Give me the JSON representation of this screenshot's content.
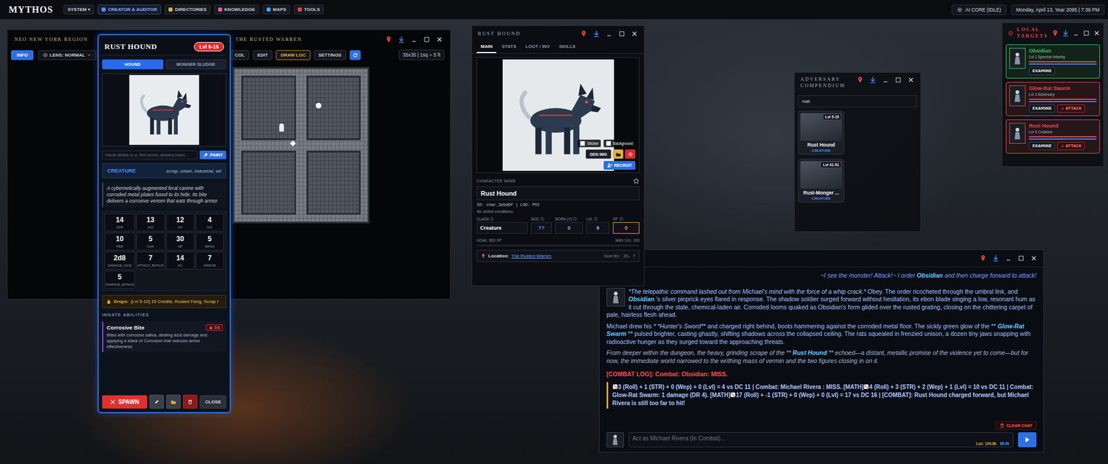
{
  "topbar": {
    "logo": "MYTHOS",
    "menu": [
      {
        "label": "SYSTEM ▾",
        "color": "",
        "selected": false
      },
      {
        "label": "CREATOR & AUDITOR",
        "color": "#5b8cff",
        "selected": true
      },
      {
        "label": "DIRECTORIES",
        "color": "#e0b040",
        "selected": false
      },
      {
        "label": "KNOWLEDGE",
        "color": "#e05fa8",
        "selected": false
      },
      {
        "label": "MAPS",
        "color": "#4aa3ff",
        "selected": false
      },
      {
        "label": "TOOLS",
        "color": "#e04848",
        "selected": false
      }
    ],
    "ai_status": "AI CORE (IDLE)",
    "clock": "Monday, April 13, Year 2095 | 7:36 PM"
  },
  "map_window": {
    "title_left": "NEO NEW YORK REGION",
    "title_right": "THE RUSTED WARREN",
    "toolbar_left": [
      {
        "label": "INFO",
        "kind": "primary"
      },
      {
        "label": "LENS: NORMAL",
        "kind": "select"
      }
    ],
    "toolbar_right": [
      {
        "label": "COL",
        "kind": "plain"
      },
      {
        "label": "EDIT",
        "kind": "plain"
      },
      {
        "label": "DRAW LOC",
        "kind": "warn"
      },
      {
        "label": "SETTINGS",
        "kind": "plain"
      }
    ],
    "scale": "35x35 | 1sq = 5 ft"
  },
  "hound_card": {
    "title": "RUST HOUND",
    "level": "Lvl 5-15",
    "tabs": [
      {
        "label": "HOUND",
        "selected": true
      },
      {
        "label": "MONGER SLUDGE",
        "selected": false
      }
    ],
    "visual_placeholder": "Visual details (e.g. Red armor, glowing eyes)...",
    "paint_button": "PAINT",
    "type": "CREATURE",
    "tags": "scrap, urban, industrial, wil",
    "description": "A cybernetically augmented feral canine with corroded metal plates fused to its hide. Its bite delivers a corrosive venom that eats through armor",
    "stats": [
      {
        "value": "14",
        "label": "STR"
      },
      {
        "value": "13",
        "label": "AGI"
      },
      {
        "value": "12",
        "label": "VIT"
      },
      {
        "value": "4",
        "label": "INT"
      },
      {
        "value": "10",
        "label": "PER"
      },
      {
        "value": "5",
        "label": "CHA"
      },
      {
        "value": "30",
        "label": "HP"
      },
      {
        "value": "5",
        "label": "MANA"
      },
      {
        "value": "2d8",
        "label": "DAMAGE_DICE"
      },
      {
        "value": "7",
        "label": "ATTACK_BONUS"
      },
      {
        "value": "14",
        "label": "AC"
      },
      {
        "value": "7",
        "label": "ARMOR"
      },
      {
        "value": "5",
        "label": "DAMAGE_BONUS"
      }
    ],
    "drops_label": "Drops:",
    "drops": "[Lvl 5-10] 15 Credits, Rusted Fang, Scrap I",
    "abilities_title": "INNATE ABILITIES",
    "abilities": [
      {
        "name": "Corrosive Bite",
        "badge": "5/6",
        "description": "Bites with corrosive saliva, dealing acid damage and applying a stack of Corrosion that reduces armor effectiveness."
      }
    ],
    "spawn_button": "SPAWN",
    "close_button": "CLOSE"
  },
  "char_window": {
    "title": "RUST HOUND",
    "tabs": [
      {
        "label": "MAIN",
        "selected": true
      },
      {
        "label": "STATS",
        "selected": false
      },
      {
        "label": "LOOT / INV",
        "selected": false
      },
      {
        "label": "SKILLS",
        "selected": false
      }
    ],
    "toggles": [
      {
        "label": "Sticker",
        "checked": false
      },
      {
        "label": "Background",
        "checked": false
      }
    ],
    "gen_button": "GEN IMG",
    "recruit_button": "RECRUIT",
    "name_label": "CHARACTER NAME",
    "name": "Rust Hound",
    "favorite": false,
    "meta": "ID: char_3ebd6f | LOD: POI",
    "conditions": "No active conditions.",
    "fields": [
      {
        "label": "CLASS",
        "value": "Creature",
        "color": "#ffffff",
        "highlight": false
      },
      {
        "label": "AGE",
        "value": "??",
        "color": "#5b8cff",
        "highlight": false
      },
      {
        "label": "BORN (Y)",
        "value": "0",
        "color": "#9aa4b8",
        "highlight": false
      },
      {
        "label": "LVL",
        "value": "9",
        "color": "#8fb4ff",
        "highlight": false
      },
      {
        "label": "XP",
        "value": "0",
        "color": "#d9a040",
        "highlight": true
      }
    ],
    "goal": "GOAL: 800 XP",
    "max_level": "MAX LVL: 100",
    "xp_level": 0,
    "location_label": "Location:",
    "location": "The Rusted Warren",
    "coords": "Coords: 23, 7"
  },
  "compendium": {
    "title": "ADVERSARY COMPENDIUM",
    "search": "rust",
    "cards": [
      {
        "name": "Rust Hound",
        "level": "Lvl 5-15",
        "type": "CREATURE"
      },
      {
        "name": "Rust-Monger ...",
        "level": "Lvl 41-51",
        "type": "CREATURE"
      }
    ]
  },
  "targets": {
    "title": "LOCAL TARGETS",
    "items": [
      {
        "name": "Obsidian",
        "subtitle": "Lvl 1 Spectral Infantry",
        "color": "#3fbf5a",
        "bars": [
          {
            "level": 1,
            "color": "#e04848"
          },
          {
            "level": 1,
            "color": "#4a7dff"
          }
        ],
        "actions": [
          {
            "label": "EXAMINE",
            "kind": "examine"
          }
        ]
      },
      {
        "name": "Glow-Rat Swarm",
        "subtitle": "Lvl 3 Adversary",
        "color": "#e04848",
        "bars": [
          {
            "level": 1,
            "color": "#e04848"
          },
          {
            "level": 1,
            "color": "#4a7dff"
          }
        ],
        "actions": [
          {
            "label": "EXAMINE",
            "kind": "examine"
          },
          {
            "label": "⚔ ATTACK",
            "kind": "attack"
          }
        ]
      },
      {
        "name": "Rust Hound",
        "subtitle": "Lvl 9 Creature",
        "color": "#e04848",
        "bars": [
          {
            "level": 1,
            "color": "#e04848"
          },
          {
            "level": 1,
            "color": "#4a7dff"
          }
        ],
        "actions": [
          {
            "label": "EXAMINE",
            "kind": "examine"
          },
          {
            "label": "⚔ ATTACK",
            "kind": "attack"
          }
        ]
      }
    ]
  },
  "chat": {
    "user_message": [
      {
        "text": "~I see the monster! Attack!~ I order ",
        "kind": "plain"
      },
      {
        "text": "Obsidian",
        "kind": "name"
      },
      {
        "text": " and then charge forward to attack!",
        "kind": "plain"
      }
    ],
    "paragraphs": [
      {
        "style": "normal",
        "avatar": true,
        "spans": [
          {
            "text": "*The telepathic command lashed out from Michael's mind with the force of a whip crack.*",
            "kind": "italic"
          },
          {
            "text": " Obey. The order ricocheted through the umbral link, and ",
            "kind": "plain"
          },
          {
            "text": "Obsidian",
            "kind": "name"
          },
          {
            "text": " 's silver pinprick eyes flared in response. The shadow soldier surged forward without hesitation, its ebon blade singing a low, resonant hum as it cut through the stale, chemical-laden air. Corroded looms quaked as Obsidian's form glided over the rusted grating, closing on the chittering carpet of pale, hairless flesh ahead.",
            "kind": "plain"
          }
        ]
      },
      {
        "style": "normal",
        "avatar": false,
        "spans": [
          {
            "text": "Michael drew his ",
            "kind": "plain"
          },
          {
            "text": "* *Hunter's Sword**",
            "kind": "italic"
          },
          {
            "text": " and charged right behind, boots hammering against the corroded metal floor. The sickly green glow of the ** ",
            "kind": "plain"
          },
          {
            "text": "Glow-Rat Swarm",
            "kind": "name"
          },
          {
            "text": " ** pulsed brighter, casting ghastly, shifting shadows across the collapsed ceiling. The rats squealed in frenzied unison, a dozen tiny jaws snapping with radioactive hunger as they surged toward the approaching threats.",
            "kind": "plain"
          }
        ]
      },
      {
        "style": "aside",
        "avatar": false,
        "spans": [
          {
            "text": "From deeper within the dungeon, the heavy, grinding scrape of the ** ",
            "kind": "plain"
          },
          {
            "text": "Rust Hound",
            "kind": "name"
          },
          {
            "text": " ** echoed—a distant, metallic promise of the violence yet to come—but for now, the immediate world narrowed to the writhing mass of vermin and the two figures closing in on it.",
            "kind": "plain"
          }
        ]
      }
    ],
    "combat_title": "[COMBAT LOG]: Combat: Obsidian: MISS.",
    "combat_log": [
      {
        "dice": true,
        "text": "3 (Roll) + 1 (STR) + 0 (Wep) + 0 (Lvl) = 4 vs DC 11 | Combat:  Michael Rivera : MISS. [MATH]"
      },
      {
        "dice": true,
        "text": "4 (Roll) + 3 (STR) + 2 (Wep) + 1 (Lvl) = 10 vs DC 11 | Combat: Glow-Rat Swarm: 1 damage (DR 4). [MATH]"
      },
      {
        "dice": true,
        "text": "17 (Roll) + -1 (STR) + 0 (Wep) + 0 (Lvl) = 17 vs DC 16 | [COMBAT]: Rust Hound charged forward, but Michael Rivera is still too far to hit!"
      }
    ],
    "clear_button": "CLEAR CHAT",
    "input_placeholder": "Act as Michael Rivera (In Combat)...",
    "counters": [
      {
        "label": "Loc: 104.8k",
        "color": "#e0b040"
      },
      {
        "label": "68.0k",
        "color": "#4aa3ff"
      }
    ]
  }
}
